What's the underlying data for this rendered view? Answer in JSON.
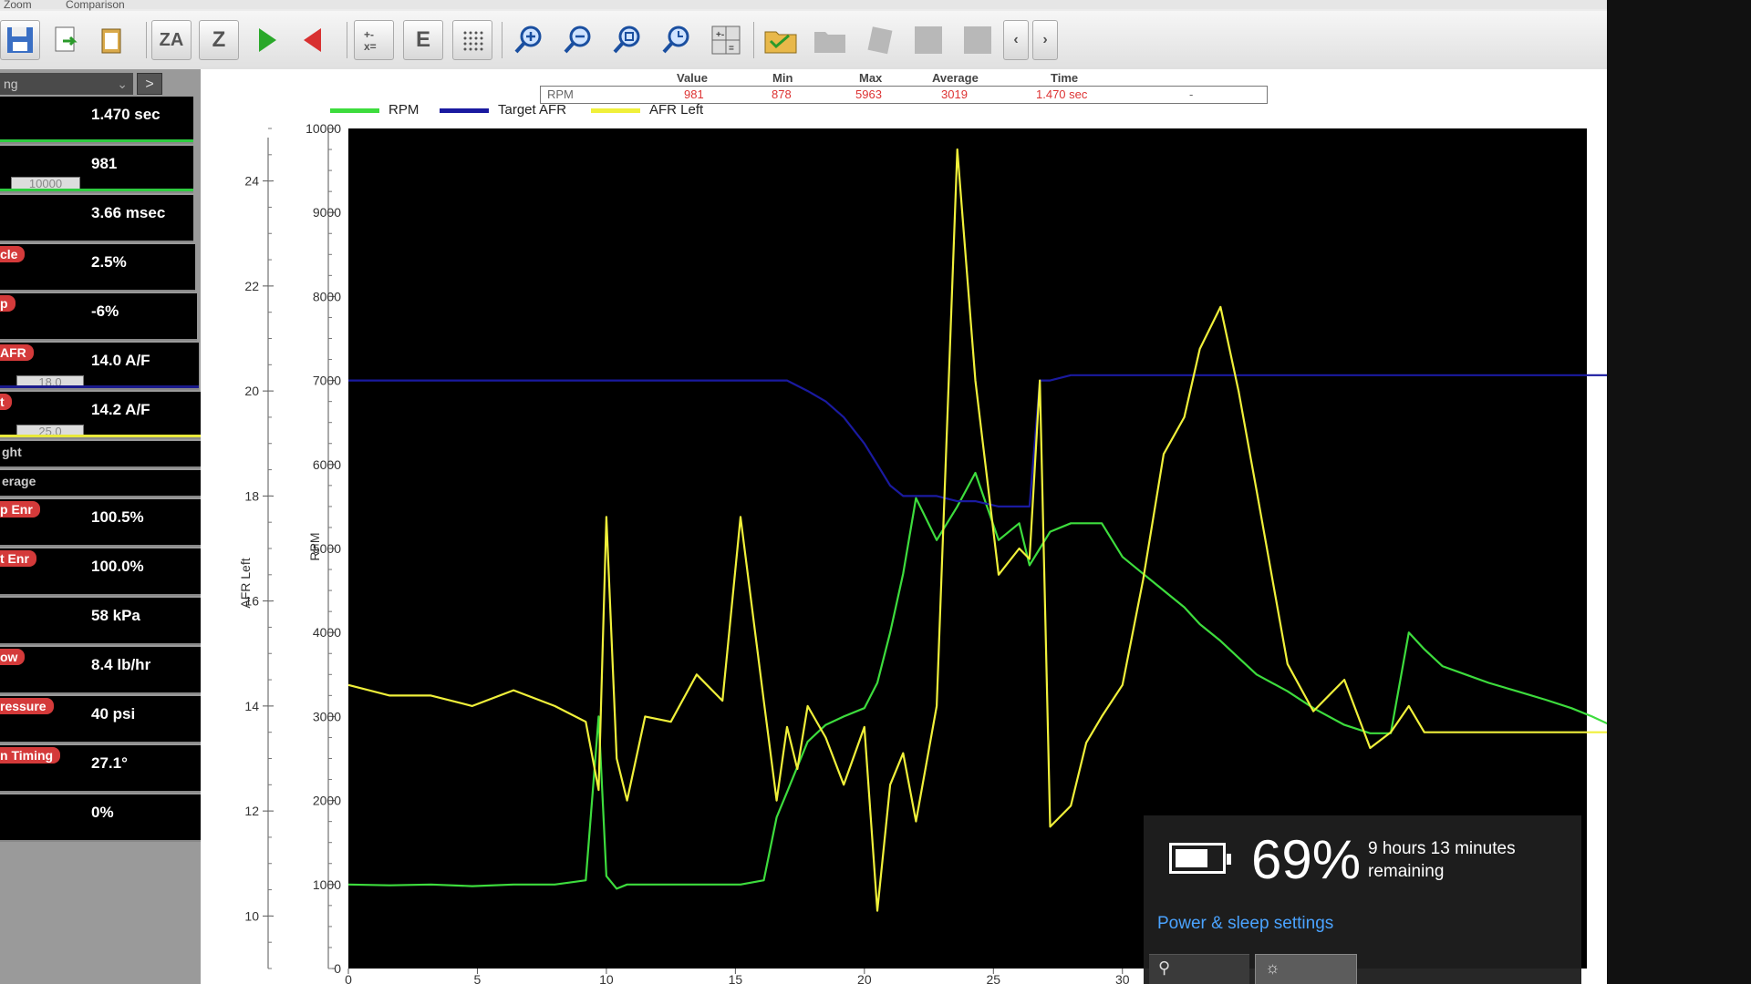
{
  "menu": [
    "Zoom",
    "Comparison"
  ],
  "toolbar": {
    "za_label": "ZA",
    "z_label": "Z",
    "e_label": "E",
    "nav_prev": "‹",
    "nav_next": "›"
  },
  "sidebar": {
    "select_value": "ng",
    "next_label": ">",
    "gauges": [
      {
        "label": "",
        "value": "1.470 sec",
        "limit": "",
        "bar": "#2ecc40"
      },
      {
        "label": "",
        "value": "981",
        "limit": "10000",
        "bar": "#2ecc40"
      },
      {
        "label": "",
        "value": "3.66 msec",
        "limit": "",
        "bar": ""
      },
      {
        "label": "cle",
        "value": "2.5%",
        "limit": "",
        "bar": ""
      },
      {
        "label": "p",
        "value": "-6%",
        "limit": "",
        "bar": ""
      },
      {
        "label": "AFR",
        "value": "14.0 A/F",
        "limit": "18.0",
        "bar": "#1a1a8c"
      },
      {
        "label": "t",
        "value": "14.2 A/F",
        "limit": "25.0",
        "bar": "#e8e83a"
      },
      {
        "plain": "ght",
        "value": ""
      },
      {
        "plain": "erage",
        "value": ""
      },
      {
        "label": "p Enr",
        "value": "100.5%",
        "limit": "",
        "bar": ""
      },
      {
        "label": "t Enr",
        "value": "100.0%",
        "limit": "",
        "bar": ""
      },
      {
        "label": "",
        "value": "58 kPa",
        "limit": "",
        "bar": ""
      },
      {
        "label": "ow",
        "value": "8.4 lb/hr",
        "limit": "",
        "bar": ""
      },
      {
        "label": "ressure",
        "value": "40 psi",
        "limit": "",
        "bar": ""
      },
      {
        "label": "n Timing",
        "value": "27.1°",
        "limit": "",
        "bar": ""
      },
      {
        "label": "",
        "value": "0%",
        "limit": "",
        "bar": ""
      }
    ]
  },
  "stats": {
    "headers": [
      "Value",
      "Min",
      "Max",
      "Average",
      "Time"
    ],
    "row_label": "RPM",
    "values": [
      "981",
      "878",
      "5963",
      "3019",
      "1.470 sec"
    ],
    "trailing": "-"
  },
  "chart_data": {
    "type": "line",
    "legend_position": "top-left",
    "background": "#000000",
    "x": [
      0,
      1.6,
      3.2,
      4.8,
      6.4,
      8,
      9.2,
      9.7,
      10,
      10.4,
      10.8,
      11.5,
      12.5,
      13.5,
      14.5,
      15.2,
      16.1,
      16.6,
      17,
      17.4,
      17.8,
      18.5,
      19.2,
      20,
      20.5,
      21,
      21.5,
      22,
      22.8,
      23.6,
      24.3,
      25.2,
      26,
      26.4,
      26.8,
      27.2,
      28,
      28.6,
      29.2,
      30,
      30.8,
      31.6,
      32.4,
      33,
      33.8,
      34.5,
      35.2,
      36.4,
      37.4,
      38.6,
      39.6,
      40.4,
      41.1,
      41.7,
      42.4,
      43.3,
      44.2,
      45.3,
      46.4,
      47.4,
      48.2,
      48.9,
      49.3,
      49.8,
      50.4,
      50.8,
      51.3
    ],
    "xlim": [
      0,
      48
    ],
    "x_ticks": [
      "0",
      "5",
      "10",
      "15",
      "20",
      "25",
      "30"
    ],
    "left_axes": [
      {
        "label": "AFR Left",
        "ylim": [
          9,
          25
        ],
        "ticks": [
          "10",
          "12",
          "14",
          "16",
          "18",
          "20",
          "22",
          "24"
        ]
      },
      {
        "label": "RPM",
        "ylim": [
          0,
          10000
        ],
        "ticks": [
          "0",
          "1000",
          "2000",
          "3000",
          "4000",
          "5000",
          "6000",
          "7000",
          "8000",
          "9000",
          "10000"
        ]
      }
    ],
    "series": [
      {
        "name": "RPM",
        "color": "#3ddc3d",
        "axis": 1,
        "values": [
          1000,
          990,
          1000,
          980,
          1000,
          1000,
          1050,
          3000,
          1100,
          950,
          1000,
          1000,
          1000,
          1000,
          1000,
          1000,
          1050,
          1800,
          2100,
          2400,
          2700,
          2900,
          3000,
          3100,
          3400,
          4000,
          4700,
          5600,
          5100,
          5500,
          5900,
          5100,
          5300,
          4800,
          5000,
          5200,
          5300,
          5300,
          5300,
          4900,
          4700,
          4500,
          4300,
          4100,
          3900,
          3700,
          3500,
          3300,
          3100,
          2900,
          2800,
          2800,
          4000,
          3800,
          3600,
          3500,
          3400,
          3300,
          3200,
          3100,
          3000,
          2900,
          2850,
          2800,
          2800,
          2800,
          2800
        ]
      },
      {
        "name": "Target AFR",
        "color": "#1a1aa0",
        "axis": 0,
        "values": [
          20.2,
          20.2,
          20.2,
          20.2,
          20.2,
          20.2,
          20.2,
          20.2,
          20.2,
          20.2,
          20.2,
          20.2,
          20.2,
          20.2,
          20.2,
          20.2,
          20.2,
          20.2,
          20.2,
          20.1,
          20.0,
          19.8,
          19.5,
          19.0,
          18.6,
          18.2,
          18.0,
          18.0,
          18.0,
          17.9,
          17.9,
          17.8,
          17.8,
          17.8,
          20.2,
          20.2,
          20.3,
          20.3,
          20.3,
          20.3,
          20.3,
          20.3,
          20.3,
          20.3,
          20.3,
          20.3,
          20.3,
          20.3,
          20.3,
          20.3,
          20.3,
          20.3,
          20.3,
          20.3,
          20.3,
          20.3,
          20.3,
          20.3,
          20.3,
          20.3,
          20.3,
          20.3,
          20.3,
          20.3,
          20.3,
          20.3,
          20.3
        ]
      },
      {
        "name": "AFR Left",
        "color": "#f0f03a",
        "axis": 0,
        "values": [
          14.4,
          14.2,
          14.2,
          14.0,
          14.3,
          14.0,
          13.7,
          12.4,
          17.6,
          13.0,
          12.2,
          13.8,
          13.7,
          14.6,
          14.1,
          17.6,
          14.1,
          12.2,
          13.6,
          12.8,
          14.0,
          13.4,
          12.5,
          13.6,
          10.1,
          12.5,
          13.1,
          11.8,
          14.0,
          24.6,
          20.2,
          16.5,
          17.0,
          16.8,
          20.2,
          11.7,
          12.1,
          13.3,
          13.8,
          14.4,
          16.4,
          18.8,
          19.5,
          20.8,
          21.6,
          20.0,
          18.1,
          14.8,
          13.9,
          14.5,
          13.2,
          13.5,
          14.0,
          13.5,
          13.5,
          13.5,
          13.5,
          13.5,
          13.5,
          13.5,
          13.5,
          13.5,
          13.5,
          13.5,
          13.5,
          13.5,
          13.5
        ]
      }
    ]
  },
  "battery": {
    "percent": "69%",
    "level": 0.69,
    "remaining": "9 hours 13 minutes remaining",
    "link": "Power & sleep settings"
  }
}
